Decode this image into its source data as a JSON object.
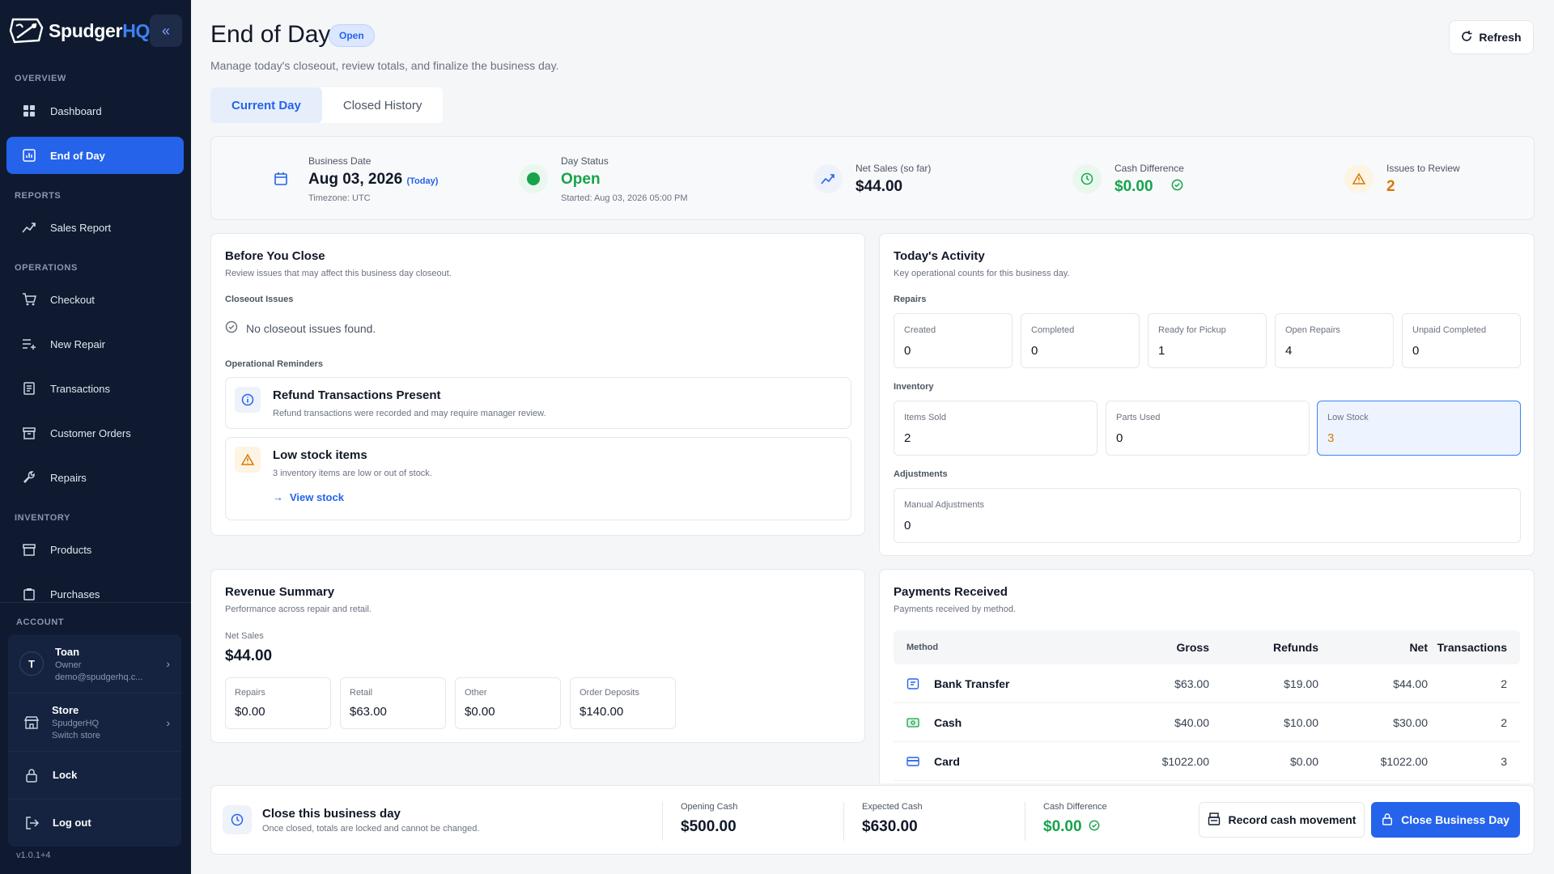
{
  "brand": {
    "name_main": "Spudger",
    "name_accent": "HQ"
  },
  "sidebar": {
    "sections": {
      "overview": "OVERVIEW",
      "reports": "REPORTS",
      "operations": "OPERATIONS",
      "inventory": "INVENTORY",
      "account": "ACCOUNT"
    },
    "items": [
      {
        "label": "Dashboard",
        "icon": "dashboard-icon"
      },
      {
        "label": "End of Day",
        "icon": "chart-icon",
        "active": true
      },
      {
        "label": "Sales Report",
        "icon": "trend-icon"
      },
      {
        "label": "Checkout",
        "icon": "cart-icon"
      },
      {
        "label": "New Repair",
        "icon": "add-list-icon"
      },
      {
        "label": "Transactions",
        "icon": "receipt-icon"
      },
      {
        "label": "Customer Orders",
        "icon": "box-icon"
      },
      {
        "label": "Repairs",
        "icon": "wrench-icon"
      },
      {
        "label": "Products",
        "icon": "archive-icon"
      },
      {
        "label": "Purchases",
        "icon": "clipboard-icon"
      }
    ],
    "account": {
      "user_initial": "T",
      "user_name": "Toan",
      "user_role": "Owner",
      "user_email": "demo@spudgerhq.c...",
      "store_title": "Store",
      "store_name": "SpudgerHQ",
      "store_action": "Switch store",
      "lock_label": "Lock",
      "logout_label": "Log out"
    },
    "version": "v1.0.1+4"
  },
  "header": {
    "title": "End of Day",
    "status": "Open",
    "subtitle": "Manage today's closeout, review totals, and finalize the business day.",
    "refresh_label": "Refresh",
    "tabs": [
      {
        "label": "Current Day",
        "active": true
      },
      {
        "label": "Closed History"
      }
    ]
  },
  "summary": {
    "business_date_label": "Business Date",
    "business_date": "Aug 03, 2026",
    "today_tag": "(Today)",
    "timezone": "Timezone: UTC",
    "day_status_label": "Day Status",
    "day_status": "Open",
    "started": "Started: Aug 03, 2026 05:00 PM",
    "net_sales_label": "Net Sales (so far)",
    "net_sales": "$44.00",
    "cash_diff_label": "Cash Difference",
    "cash_diff": "$0.00",
    "issues_label": "Issues to Review",
    "issues": "2"
  },
  "before_close": {
    "title": "Before You Close",
    "subtitle": "Review issues that may affect this business day closeout.",
    "closeout_label": "Closeout Issues",
    "no_issues": "No closeout issues found.",
    "reminders_label": "Operational Reminders",
    "reminders": [
      {
        "title": "Refund Transactions Present",
        "desc": "Refund transactions were recorded and may require manager review."
      },
      {
        "title": "Low stock items",
        "desc": "3 inventory items are low or out of stock.",
        "link": "View stock"
      }
    ]
  },
  "activity": {
    "title": "Today's Activity",
    "subtitle": "Key operational counts for this business day.",
    "repairs_label": "Repairs",
    "repairs": [
      {
        "label": "Created",
        "value": "0"
      },
      {
        "label": "Completed",
        "value": "0"
      },
      {
        "label": "Ready for Pickup",
        "value": "1"
      },
      {
        "label": "Open Repairs",
        "value": "4"
      },
      {
        "label": "Unpaid Completed",
        "value": "0"
      }
    ],
    "inventory_label": "Inventory",
    "inventory": [
      {
        "label": "Items Sold",
        "value": "2"
      },
      {
        "label": "Parts Used",
        "value": "0"
      },
      {
        "label": "Low Stock",
        "value": "3"
      }
    ],
    "adjustments_label": "Adjustments",
    "adjustments": {
      "label": "Manual Adjustments",
      "value": "0"
    }
  },
  "revenue": {
    "title": "Revenue Summary",
    "subtitle": "Performance across repair and retail.",
    "net_label": "Net Sales",
    "net_value": "$44.00",
    "boxes": [
      {
        "label": "Repairs",
        "value": "$0.00"
      },
      {
        "label": "Retail",
        "value": "$63.00"
      },
      {
        "label": "Other",
        "value": "$0.00"
      },
      {
        "label": "Order Deposits",
        "value": "$140.00"
      }
    ]
  },
  "payments": {
    "title": "Payments Received",
    "subtitle": "Payments received by method.",
    "columns": [
      "Method",
      "Gross",
      "Refunds",
      "Net",
      "Transactions"
    ],
    "rows": [
      {
        "method": "Bank Transfer",
        "gross": "$63.00",
        "refunds": "$19.00",
        "net": "$44.00",
        "count": "2",
        "icon": "bank-icon"
      },
      {
        "method": "Cash",
        "gross": "$40.00",
        "refunds": "$10.00",
        "net": "$30.00",
        "count": "2",
        "icon": "cash-icon"
      },
      {
        "method": "Card",
        "gross": "$1022.00",
        "refunds": "$0.00",
        "net": "$1022.00",
        "count": "3",
        "icon": "card-icon"
      }
    ]
  },
  "close_bar": {
    "title": "Close this business day",
    "subtitle": "Once closed, totals are locked and cannot be changed.",
    "opening_label": "Opening Cash",
    "opening": "$500.00",
    "expected_label": "Expected Cash",
    "expected": "$630.00",
    "diff_label": "Cash Difference",
    "diff": "$0.00",
    "record_label": "Record cash movement",
    "close_label": "Close Business Day"
  },
  "colors": {
    "accent": "#2563eb",
    "sidebar": "#0f1a30",
    "success": "#16a34a",
    "warning": "#d97706"
  }
}
